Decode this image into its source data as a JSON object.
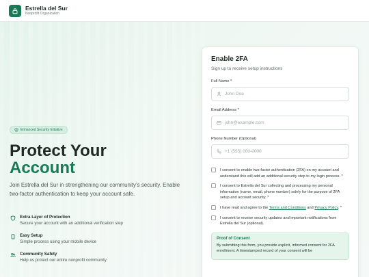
{
  "header": {
    "brand_name": "Estrella del Sur",
    "brand_sub": "Nonprofit Organization",
    "logo_icon": "lock-icon"
  },
  "hero": {
    "badge": "Enhanced Security Initiative",
    "title_line1": "Protect Your",
    "title_line2": "Account",
    "description": "Join Estrella del Sur in strengthening our community's security. Enable two-factor authentication to keep your account safe."
  },
  "features": [
    {
      "icon": "shield-icon",
      "title": "Extra Layer of Protection",
      "desc": "Secure your account with an additional verification step"
    },
    {
      "icon": "phone-icon",
      "title": "Easy Setup",
      "desc": "Simple process using your mobile device"
    },
    {
      "icon": "people-icon",
      "title": "Community Safety",
      "desc": "Help us protect our entire nonprofit community"
    }
  ],
  "form": {
    "title": "Enable 2FA",
    "subtitle": "Sign up to receive setup instructions",
    "name_label": "Full Name *",
    "name_placeholder": "John Doe",
    "email_label": "Email Address *",
    "email_placeholder": "john@example.com",
    "phone_label": "Phone Number (Optional)",
    "phone_placeholder": "+1 (555) 000-0000",
    "consent_2fa": "I consent to enable two-factor authentication (2FA) on my account and understand this will add an additional security step to my login process. *",
    "consent_data": "I consent to Estrella del Sur collecting and processing my personal information (name, email, phone number) solely for the purpose of 2FA setup and account security. *",
    "consent_terms_prefix": "I have read and agree to the ",
    "terms_link": "Terms and Conditions",
    "consent_terms_and": " and ",
    "privacy_link": "Privacy Policy",
    "consent_terms_suffix": ". *",
    "consent_updates": "I consent to receive security updates and important notifications from Estrella del Sur (optional).",
    "proof_title": "Proof of Consent",
    "proof_text": "By submitting this form, you provide explicit, informed consent for 2FA enrollment. A timestamped record of your consent will be"
  },
  "colors": {
    "brand": "#1a7a55",
    "background": "#eef6f1"
  }
}
